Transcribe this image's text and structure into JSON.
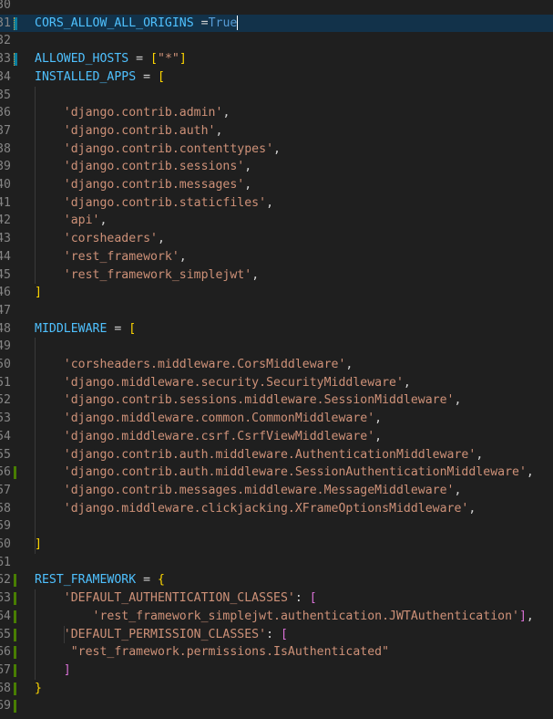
{
  "editor": {
    "language": "python",
    "lines": [
      {
        "num": "30",
        "mark": "",
        "hl": false,
        "tokens": []
      },
      {
        "num": "31",
        "mark": "mod",
        "hl": true,
        "tokens": [
          {
            "t": "CORS_ALLOW_ALL_ORIGINS",
            "c": "var"
          },
          {
            "t": " =",
            "c": "op"
          },
          {
            "t": "True",
            "c": "const"
          }
        ],
        "cursor": true
      },
      {
        "num": "32",
        "mark": "",
        "hl": false,
        "tokens": []
      },
      {
        "num": "33",
        "mark": "mod",
        "hl": false,
        "tokens": [
          {
            "t": "ALLOWED_HOSTS",
            "c": "var"
          },
          {
            "t": " = ",
            "c": "op"
          },
          {
            "t": "[",
            "c": "b1"
          },
          {
            "t": "\"*\"",
            "c": "str"
          },
          {
            "t": "]",
            "c": "b1"
          }
        ]
      },
      {
        "num": "34",
        "mark": "",
        "hl": false,
        "tokens": [
          {
            "t": "INSTALLED_APPS",
            "c": "var"
          },
          {
            "t": " = ",
            "c": "op"
          },
          {
            "t": "[",
            "c": "b1"
          }
        ]
      },
      {
        "num": "35",
        "mark": "",
        "hl": false,
        "tokens": []
      },
      {
        "num": "36",
        "mark": "",
        "hl": false,
        "tokens": [
          {
            "t": "    'django.contrib.admin'",
            "c": "str"
          },
          {
            "t": ",",
            "c": "punc"
          }
        ]
      },
      {
        "num": "37",
        "mark": "",
        "hl": false,
        "tokens": [
          {
            "t": "    'django.contrib.auth'",
            "c": "str"
          },
          {
            "t": ",",
            "c": "punc"
          }
        ]
      },
      {
        "num": "38",
        "mark": "",
        "hl": false,
        "tokens": [
          {
            "t": "    'django.contrib.contenttypes'",
            "c": "str"
          },
          {
            "t": ",",
            "c": "punc"
          }
        ]
      },
      {
        "num": "39",
        "mark": "",
        "hl": false,
        "tokens": [
          {
            "t": "    'django.contrib.sessions'",
            "c": "str"
          },
          {
            "t": ",",
            "c": "punc"
          }
        ]
      },
      {
        "num": "40",
        "mark": "",
        "hl": false,
        "tokens": [
          {
            "t": "    'django.contrib.messages'",
            "c": "str"
          },
          {
            "t": ",",
            "c": "punc"
          }
        ]
      },
      {
        "num": "41",
        "mark": "",
        "hl": false,
        "tokens": [
          {
            "t": "    'django.contrib.staticfiles'",
            "c": "str"
          },
          {
            "t": ",",
            "c": "punc"
          }
        ]
      },
      {
        "num": "42",
        "mark": "",
        "hl": false,
        "tokens": [
          {
            "t": "    'api'",
            "c": "str"
          },
          {
            "t": ",",
            "c": "punc"
          }
        ]
      },
      {
        "num": "43",
        "mark": "",
        "hl": false,
        "tokens": [
          {
            "t": "    'corsheaders'",
            "c": "str"
          },
          {
            "t": ",",
            "c": "punc"
          }
        ]
      },
      {
        "num": "44",
        "mark": "",
        "hl": false,
        "tokens": [
          {
            "t": "    'rest_framework'",
            "c": "str"
          },
          {
            "t": ",",
            "c": "punc"
          }
        ]
      },
      {
        "num": "45",
        "mark": "",
        "hl": false,
        "tokens": [
          {
            "t": "    'rest_framework_simplejwt'",
            "c": "str"
          },
          {
            "t": ",",
            "c": "punc"
          }
        ]
      },
      {
        "num": "46",
        "mark": "",
        "hl": false,
        "tokens": [
          {
            "t": "]",
            "c": "b1"
          }
        ]
      },
      {
        "num": "47",
        "mark": "",
        "hl": false,
        "tokens": []
      },
      {
        "num": "48",
        "mark": "",
        "hl": false,
        "tokens": [
          {
            "t": "MIDDLEWARE",
            "c": "var"
          },
          {
            "t": " = ",
            "c": "op"
          },
          {
            "t": "[",
            "c": "b1"
          }
        ]
      },
      {
        "num": "49",
        "mark": "",
        "hl": false,
        "tokens": []
      },
      {
        "num": "50",
        "mark": "",
        "hl": false,
        "tokens": [
          {
            "t": "    'corsheaders.middleware.CorsMiddleware'",
            "c": "str"
          },
          {
            "t": ",",
            "c": "punc"
          }
        ]
      },
      {
        "num": "51",
        "mark": "",
        "hl": false,
        "tokens": [
          {
            "t": "    'django.middleware.security.SecurityMiddleware'",
            "c": "str"
          },
          {
            "t": ",",
            "c": "punc"
          }
        ]
      },
      {
        "num": "52",
        "mark": "",
        "hl": false,
        "tokens": [
          {
            "t": "    'django.contrib.sessions.middleware.SessionMiddleware'",
            "c": "str"
          },
          {
            "t": ",",
            "c": "punc"
          }
        ]
      },
      {
        "num": "53",
        "mark": "",
        "hl": false,
        "tokens": [
          {
            "t": "    'django.middleware.common.CommonMiddleware'",
            "c": "str"
          },
          {
            "t": ",",
            "c": "punc"
          }
        ]
      },
      {
        "num": "54",
        "mark": "",
        "hl": false,
        "tokens": [
          {
            "t": "    'django.middleware.csrf.CsrfViewMiddleware'",
            "c": "str"
          },
          {
            "t": ",",
            "c": "punc"
          }
        ]
      },
      {
        "num": "55",
        "mark": "",
        "hl": false,
        "tokens": [
          {
            "t": "    'django.contrib.auth.middleware.AuthenticationMiddleware'",
            "c": "str"
          },
          {
            "t": ",",
            "c": "punc"
          }
        ]
      },
      {
        "num": "56",
        "mark": "add",
        "hl": false,
        "tokens": [
          {
            "t": "    'django.contrib.auth.middleware.SessionAuthenticationMiddleware'",
            "c": "str"
          },
          {
            "t": ",",
            "c": "punc"
          }
        ]
      },
      {
        "num": "57",
        "mark": "",
        "hl": false,
        "tokens": [
          {
            "t": "    'django.contrib.messages.middleware.MessageMiddleware'",
            "c": "str"
          },
          {
            "t": ",",
            "c": "punc"
          }
        ]
      },
      {
        "num": "58",
        "mark": "",
        "hl": false,
        "tokens": [
          {
            "t": "    'django.middleware.clickjacking.XFrameOptionsMiddleware'",
            "c": "str"
          },
          {
            "t": ",",
            "c": "punc"
          }
        ]
      },
      {
        "num": "59",
        "mark": "",
        "hl": false,
        "tokens": []
      },
      {
        "num": "60",
        "mark": "",
        "hl": false,
        "tokens": [
          {
            "t": "]",
            "c": "b1"
          }
        ]
      },
      {
        "num": "61",
        "mark": "",
        "hl": false,
        "tokens": []
      },
      {
        "num": "62",
        "mark": "add",
        "hl": false,
        "tokens": [
          {
            "t": "REST_FRAMEWORK",
            "c": "var"
          },
          {
            "t": " = ",
            "c": "op"
          },
          {
            "t": "{",
            "c": "b1"
          }
        ]
      },
      {
        "num": "63",
        "mark": "add",
        "hl": false,
        "tokens": [
          {
            "t": "    'DEFAULT_AUTHENTICATION_CLASSES'",
            "c": "str"
          },
          {
            "t": ": ",
            "c": "punc"
          },
          {
            "t": "[",
            "c": "b2"
          }
        ]
      },
      {
        "num": "64",
        "mark": "add",
        "hl": false,
        "tokens": [
          {
            "t": "        'rest_framework_simplejwt.authentication.JWTAuthentication'",
            "c": "str"
          },
          {
            "t": "]",
            "c": "b2"
          },
          {
            "t": ",",
            "c": "punc"
          }
        ]
      },
      {
        "num": "65",
        "mark": "add",
        "hl": false,
        "tokens": [
          {
            "t": "    'DEFAULT_PERMISSION_CLASSES'",
            "c": "str"
          },
          {
            "t": ": ",
            "c": "punc"
          },
          {
            "t": "[",
            "c": "b2"
          }
        ]
      },
      {
        "num": "66",
        "mark": "add",
        "hl": false,
        "tokens": [
          {
            "t": "     \"rest_framework.permissions.IsAuthenticated\"",
            "c": "str"
          }
        ]
      },
      {
        "num": "67",
        "mark": "add",
        "hl": false,
        "tokens": [
          {
            "t": "    ]",
            "c": "b2"
          }
        ]
      },
      {
        "num": "68",
        "mark": "add",
        "hl": false,
        "tokens": [
          {
            "t": "}",
            "c": "b1"
          }
        ]
      },
      {
        "num": "69",
        "mark": "add",
        "hl": false,
        "tokens": []
      }
    ]
  }
}
